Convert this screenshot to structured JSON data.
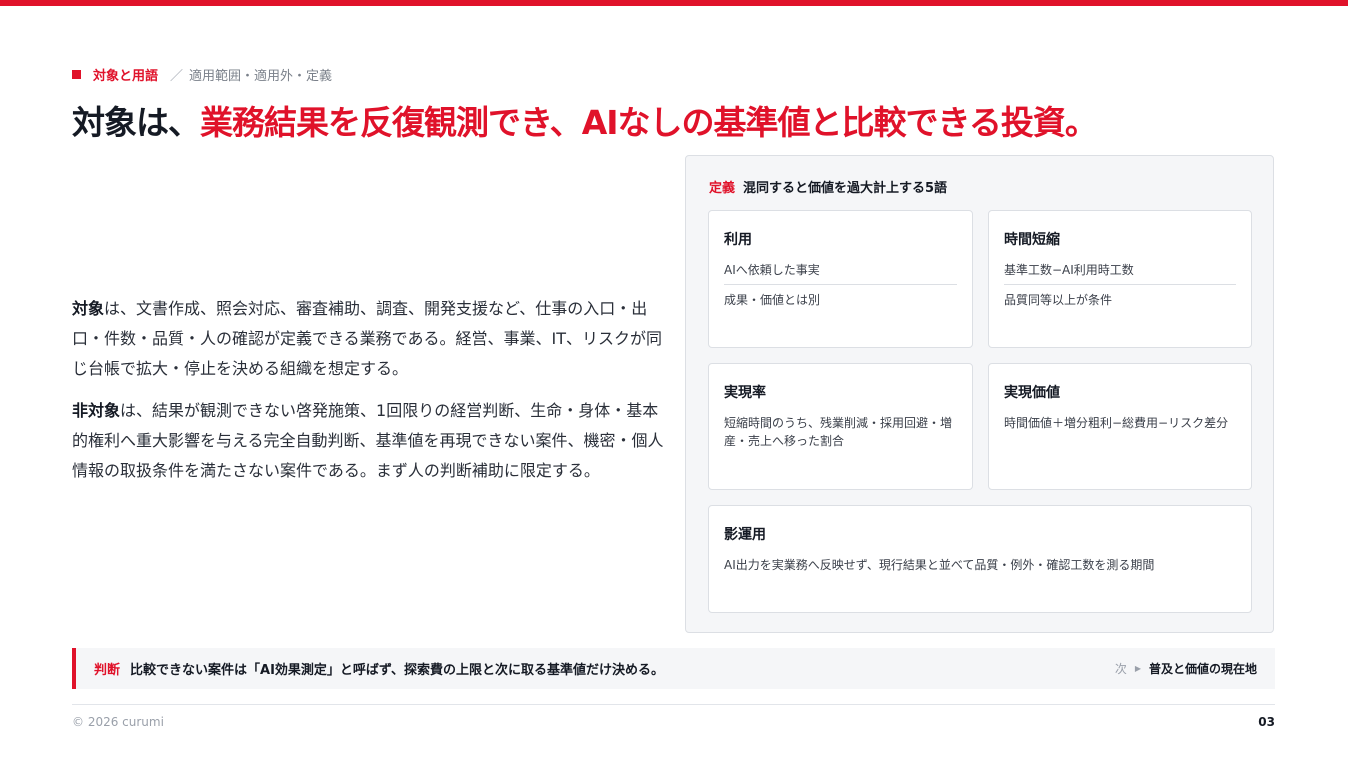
{
  "section": {
    "main": "対象と用語",
    "slash": "／",
    "sub": "適用範囲・適用外・定義"
  },
  "headline": {
    "dark": "対象は、",
    "red": "業務結果を反復観測でき、AIなしの基準値と比較できる投資。"
  },
  "body": {
    "para1_lead": "対象",
    "para1_text": "は、文書作成、照会対応、審査補助、調査、開発支援など、仕事の入口・出口・件数・品質・人の確認が定義できる業務である。経営、事業、IT、リスクが同じ台帳で拡大・停止を決める組織を想定する。",
    "para2_lead": "非対象",
    "para2_text": "は、結果が観測できない啓発施策、1回限りの経営判断、生命・身体・基本的権利へ重大影響を与える完全自動判断、基準値を再現できない案件、機密・個人情報の取扱条件を満たさない案件である。まず人の判断補助に限定する。"
  },
  "panel": {
    "tag": "定義",
    "title": "混同すると価値を過大計上する5語",
    "cards": [
      {
        "title": "利用",
        "line1": "AIへ依頼した事実",
        "line2": "成果・価値とは別"
      },
      {
        "title": "時間短縮",
        "line1": "基準工数−AI利用時工数",
        "line2": "品質同等以上が条件"
      },
      {
        "title": "実現率",
        "line1": "短縮時間のうち、残業削減・採用回避・増産・売上へ移った割合"
      },
      {
        "title": "実現価値",
        "line1": "時間価値＋増分粗利−総費用−リスク差分"
      },
      {
        "title": "影運用",
        "line1": "AI出力を実業務へ反映せず、現行結果と並べて品質・例外・確認工数を測る期間"
      }
    ]
  },
  "judgment": {
    "tag": "判断",
    "text": "比較できない案件は「AI効果測定」と呼ばず、探索費の上限と次に取る基準値だけ決める。",
    "next_label": "次",
    "next_title": "普及と価値の現在地"
  },
  "footer": {
    "copyright": "© 2026 curumi",
    "page": "03"
  },
  "colors": {
    "accent": "#e0122a",
    "text": "#151a24",
    "panel_bg": "#f5f6f8"
  }
}
